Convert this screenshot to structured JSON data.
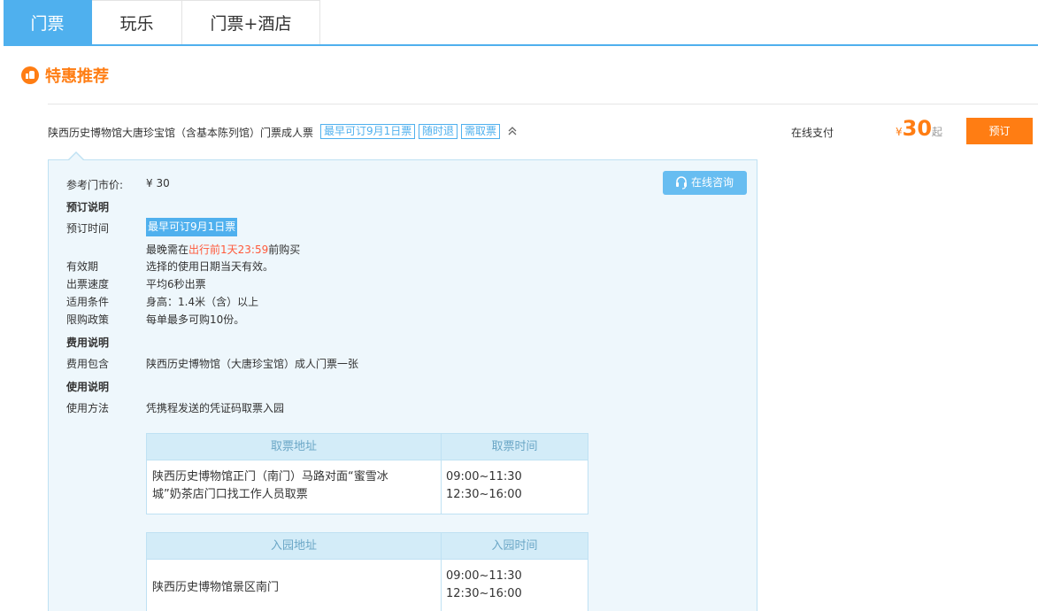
{
  "tabs": [
    {
      "label": "门票",
      "active": true
    },
    {
      "label": "玩乐",
      "active": false
    },
    {
      "label": "门票+酒店",
      "active": false
    }
  ],
  "section": {
    "title": "特惠推荐",
    "icon": "thumbs-up-icon"
  },
  "product": {
    "name": "陕西历史博物馆大唐珍宝馆（含基本陈列馆）门票成人票",
    "tags": [
      "最早可订9月1日票",
      "随时退",
      "需取票"
    ],
    "payment": "在线支付",
    "price_currency": "¥",
    "price": "30",
    "price_suffix": "起",
    "book_label": "预订"
  },
  "detail": {
    "ref_price_label": "参考门市价:",
    "ref_price_value": "¥ 30",
    "consult_label": "在线咨询",
    "booking_heading": "预订说明",
    "booking_time_label": "预订时间",
    "booking_time_tag": "最早可订9月1日票",
    "latest_prefix": "最晚需在",
    "latest_highlight": "出行前1天23:59",
    "latest_suffix": "前购买",
    "validity_label": "有效期",
    "validity_value": "选择的使用日期当天有效。",
    "speed_label": "出票速度",
    "speed_value": "平均6秒出票",
    "condition_label": "适用条件",
    "condition_value": "身高：1.4米（含）以上",
    "limit_label": "限购政策",
    "limit_value": "每单最多可购10份。",
    "fee_heading": "费用说明",
    "fee_include_label": "费用包含",
    "fee_include_value": "陕西历史博物馆（大唐珍宝馆）成人门票一张",
    "usage_heading": "使用说明",
    "usage_method_label": "使用方法",
    "usage_method_value": "凭携程发送的凭证码取票入园"
  },
  "pickup_table": {
    "headers": [
      "取票地址",
      "取票时间"
    ],
    "address_line1": "陕西历史博物馆正门（南门）马路对面“蜜雪冰",
    "address_line2": "城”奶茶店门口找工作人员取票",
    "time_line1": "09:00~11:30",
    "time_line2": "12:30~16:00"
  },
  "entry_table": {
    "headers": [
      "入园地址",
      "入园时间"
    ],
    "address": "陕西历史博物馆景区南门",
    "time_line1": "09:00~11:30",
    "time_line2": "12:30~16:00"
  },
  "colors": {
    "accent": "#4fb0ee",
    "orange": "#ff7d13",
    "panel_bg": "#eef7fc"
  }
}
